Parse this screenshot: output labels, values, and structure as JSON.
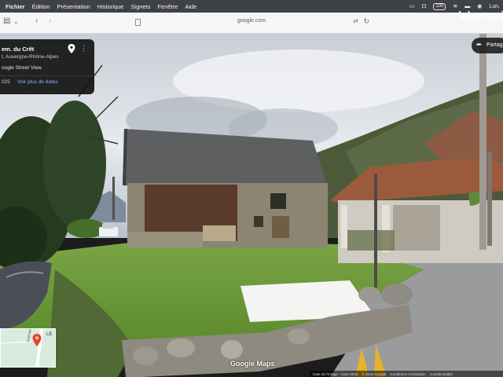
{
  "menubar": {
    "items": [
      "Fichier",
      "Édition",
      "Présentation",
      "Historique",
      "Signets",
      "Fenêtre",
      "Aide"
    ],
    "battery": "100",
    "clock": "Lun."
  },
  "browser": {
    "url": "google.com"
  },
  "watermark": "leboncoin",
  "info_card": {
    "place": "em. du Crêt",
    "region": "t, Auvergne-Rhône-Alpes",
    "source": "oogle Street View",
    "date": "025",
    "more_dates_link": "Voir plus de dates"
  },
  "share": {
    "label": "Partag"
  },
  "minimap": {
    "label_top": "LE",
    "label_road": "Avenue"
  },
  "maps_logo": "Google Maps",
  "footer": {
    "capture": "Date de l'image : mars 2025",
    "copyright": "© 2025 Google",
    "terms": "Conditions d'utilisation",
    "privacy": "Confidentialité"
  },
  "colors": {
    "menubar": "#3f4148",
    "card": "#121212",
    "link": "#8ab4f8",
    "grass": "#6f9a3c",
    "roof": "#5c5d5e",
    "sky": "#dfe4ea"
  }
}
